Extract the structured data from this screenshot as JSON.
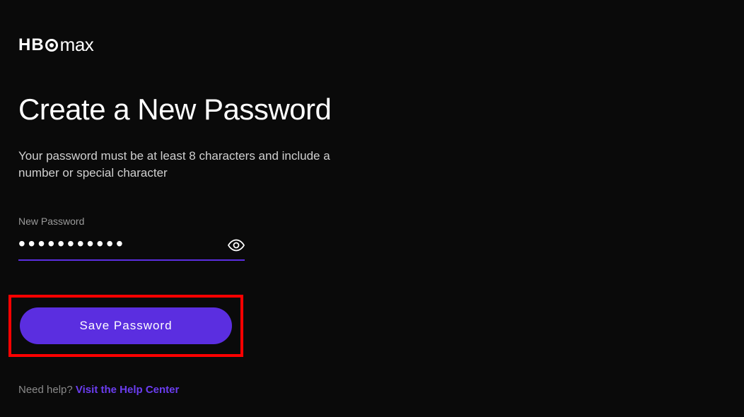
{
  "brand": {
    "name": "HBO max"
  },
  "page": {
    "title": "Create a New Password",
    "subtitle": "Your password must be at least 8 characters and include a number or special character"
  },
  "form": {
    "password_label": "New Password",
    "password_value": "●●●●●●●●●●●",
    "save_button_label": "Save Password"
  },
  "footer": {
    "help_prompt": "Need help?",
    "help_link_text": "Visit the Help Center"
  },
  "colors": {
    "accent": "#5b2ee0",
    "highlight": "#ff0000",
    "background": "#0a0a0a"
  }
}
